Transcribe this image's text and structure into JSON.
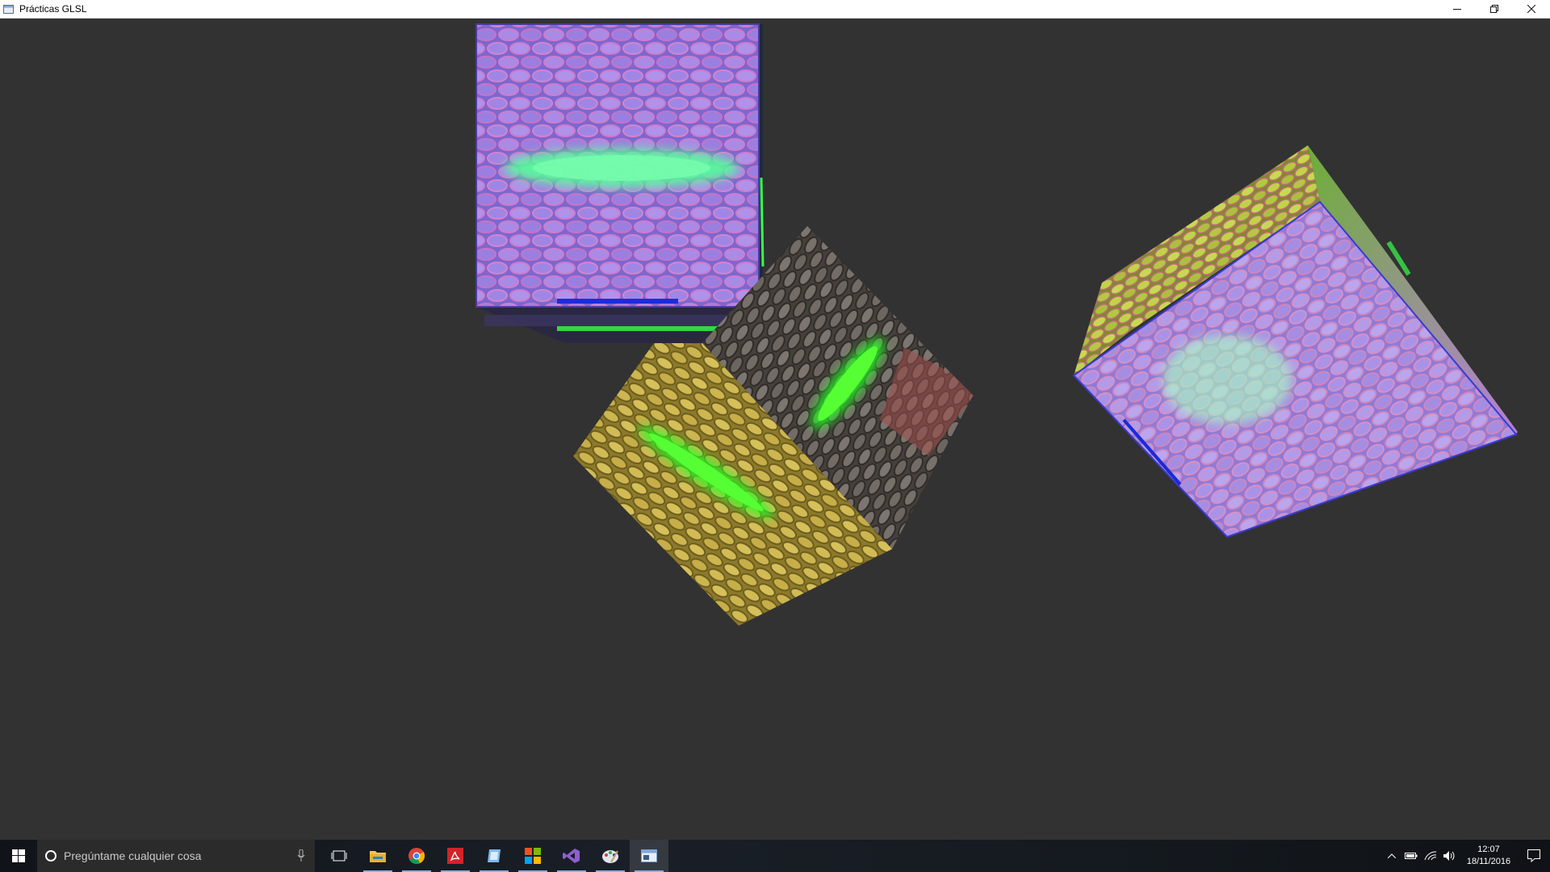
{
  "window": {
    "title": "Prácticas GLSL",
    "app_icon": "app-window-icon",
    "controls": [
      "minimize-icon",
      "restore-icon",
      "close-icon"
    ]
  },
  "scene": {
    "background": "#323232",
    "cubes": [
      {
        "name": "cube-top",
        "emissive_color": "#44ff66",
        "texture": "normal-map-cobblestone"
      },
      {
        "name": "cube-center",
        "emissive_color": "#22ff22",
        "texture": "diffuse-cobblestone"
      },
      {
        "name": "cube-right",
        "emissive_color": "#99ff88",
        "texture": "normal-map-cobblestone"
      }
    ],
    "colors": {
      "normal_map_purple": "#8a6fd8",
      "normal_map_pink": "#d37fd0",
      "diffuse_yellow": "#c9b04a",
      "diffuse_gray": "#6a6560",
      "glow_green": "#39ff4a"
    }
  },
  "taskbar": {
    "search_placeholder": "Pregúntame cualquier cosa",
    "apps": [
      {
        "icon": "task-view-icon",
        "running": false
      },
      {
        "icon": "file-explorer-icon",
        "running": true
      },
      {
        "icon": "chrome-icon",
        "running": true
      },
      {
        "icon": "acrobat-icon",
        "running": true
      },
      {
        "icon": "app-blue-icon",
        "running": true
      },
      {
        "icon": "app-grid-icon",
        "running": true
      },
      {
        "icon": "visual-studio-icon",
        "running": true
      },
      {
        "icon": "paint-icon",
        "running": true
      },
      {
        "icon": "glsl-window-icon",
        "running": true,
        "active": true
      }
    ],
    "tray": [
      "chevron-up-icon",
      "battery-icon",
      "wifi-icon",
      "volume-icon"
    ],
    "clock": {
      "time": "12:07",
      "date": "18/11/2016"
    }
  }
}
